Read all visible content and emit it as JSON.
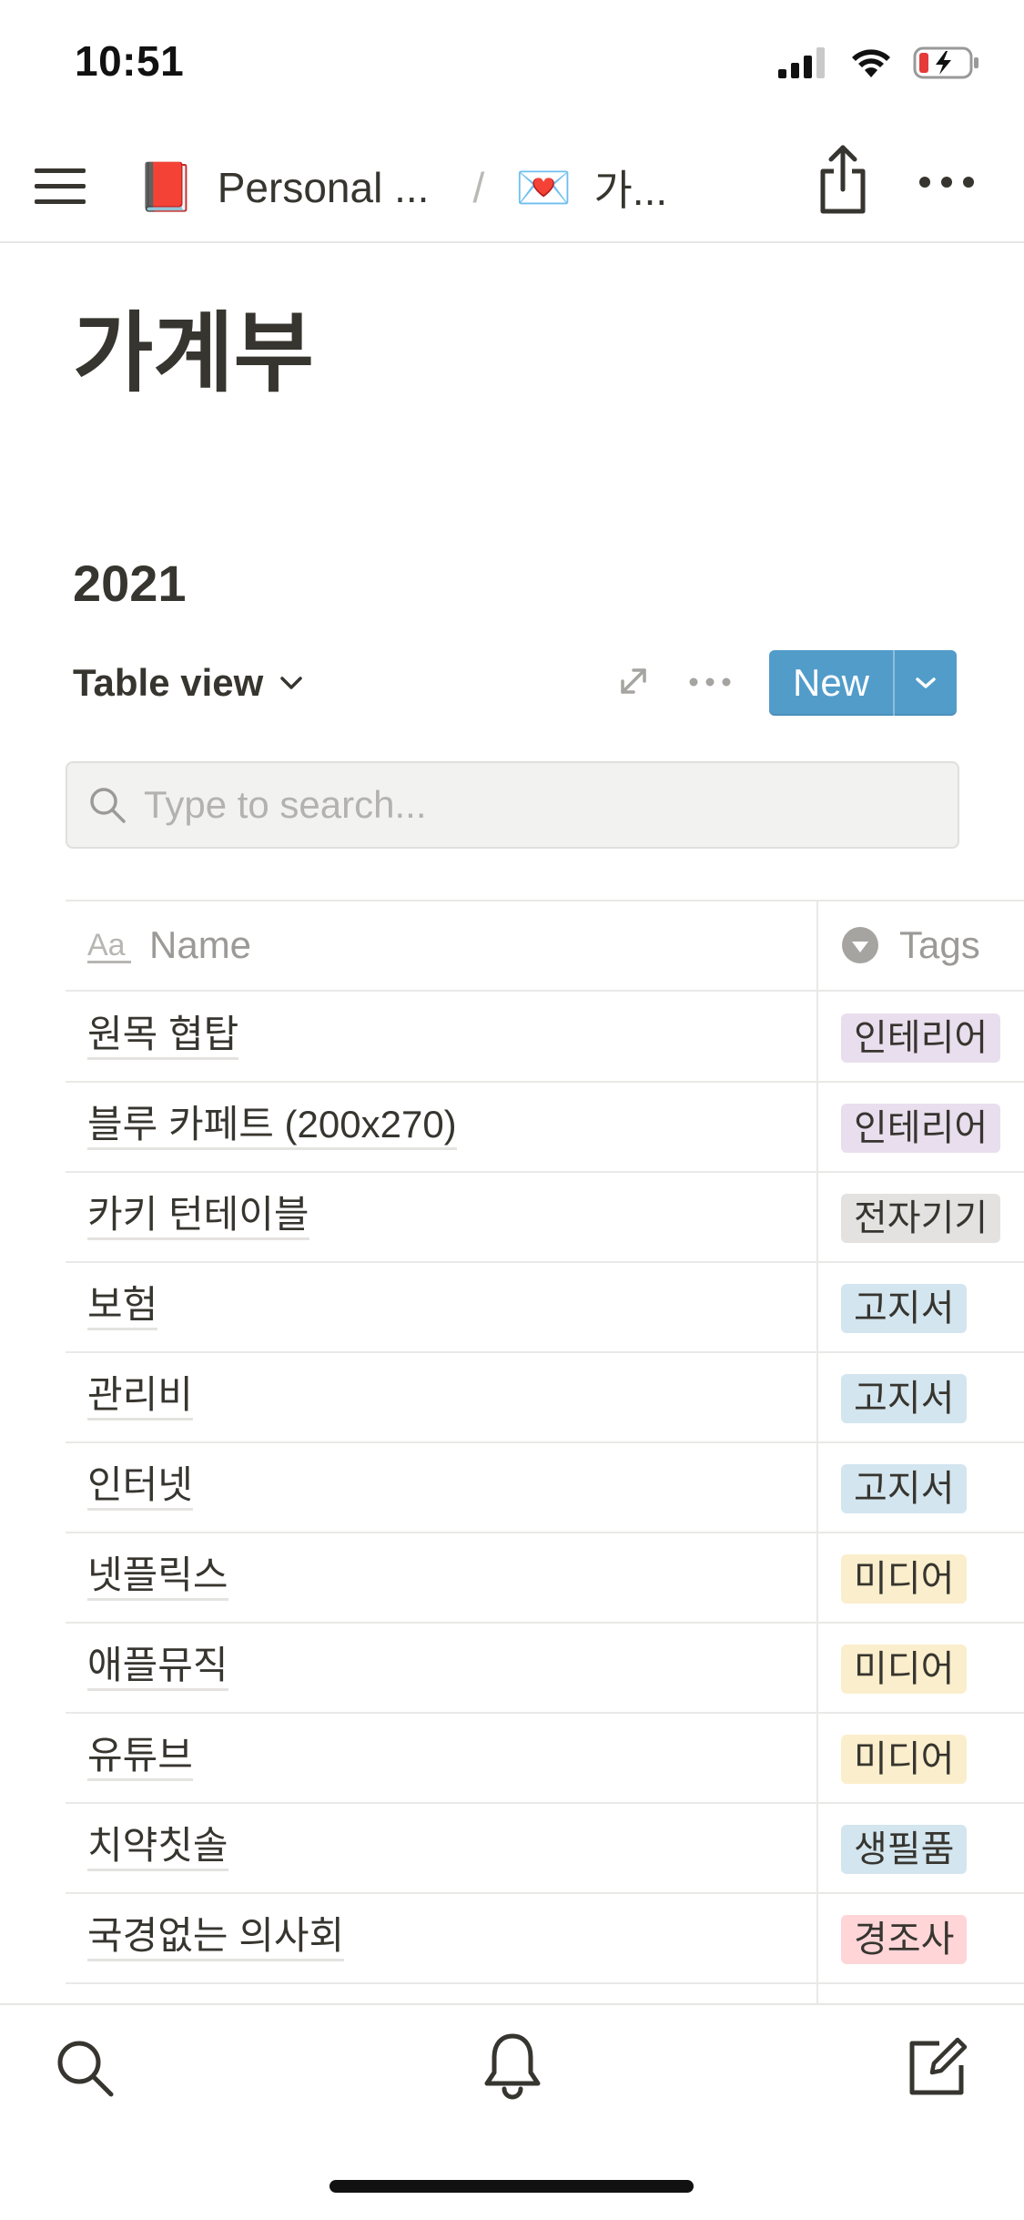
{
  "status_bar": {
    "time": "10:51"
  },
  "breadcrumb": {
    "items": [
      {
        "emoji": "📕",
        "label": "Personal ..."
      },
      {
        "emoji": "💌",
        "label": "가..."
      }
    ],
    "separator": "/"
  },
  "page": {
    "title": "가계부",
    "section_title": "2021"
  },
  "view": {
    "label": "Table view",
    "new_label": "New"
  },
  "search": {
    "placeholder": "Type to search...",
    "value": ""
  },
  "table": {
    "columns": [
      {
        "label": "Name",
        "icon": "title-property-icon"
      },
      {
        "label": "Tags",
        "icon": "select-property-icon"
      }
    ],
    "rows": [
      {
        "name": "원목 협탑",
        "tag": "인테리어",
        "tag_color": "#e8deee"
      },
      {
        "name": "블루 카페트 (200x270)",
        "tag": "인테리어",
        "tag_color": "#e8deee"
      },
      {
        "name": "카키 턴테이블",
        "tag": "전자기기",
        "tag_color": "#e3e2e0"
      },
      {
        "name": "보험",
        "tag": "고지서",
        "tag_color": "#d3e5ef"
      },
      {
        "name": "관리비",
        "tag": "고지서",
        "tag_color": "#d3e5ef"
      },
      {
        "name": "인터넷",
        "tag": "고지서",
        "tag_color": "#d3e5ef"
      },
      {
        "name": "넷플릭스",
        "tag": "미디어",
        "tag_color": "#fbeecc"
      },
      {
        "name": "애플뮤직",
        "tag": "미디어",
        "tag_color": "#fbeecc"
      },
      {
        "name": "유튜브",
        "tag": "미디어",
        "tag_color": "#fbeecc"
      },
      {
        "name": "치약칫솔",
        "tag": "생필품",
        "tag_color": "#d3e5ef"
      },
      {
        "name": "국경없는 의사회",
        "tag": "경조사",
        "tag_color": "#ffd5d8"
      }
    ]
  },
  "colors": {
    "accent": "#529cca",
    "text": "#37352f",
    "muted": "#9b9a97"
  }
}
